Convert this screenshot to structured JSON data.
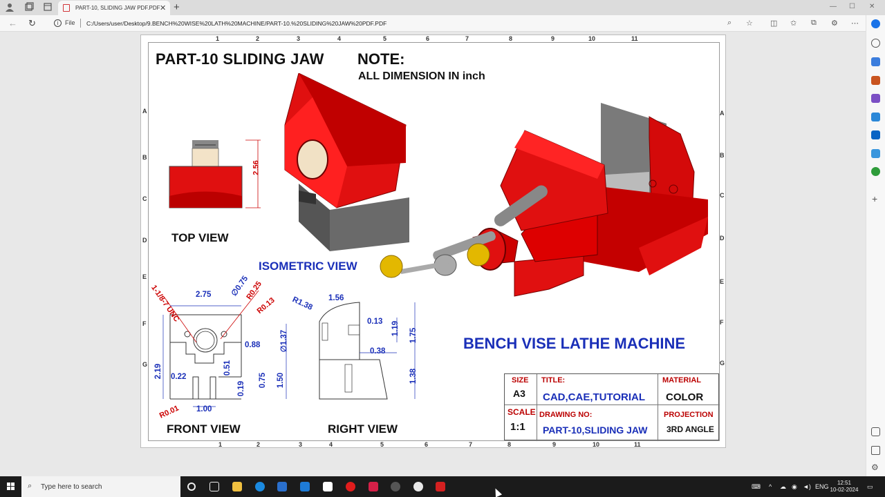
{
  "browser": {
    "tab_title": "PART-10, SLIDING JAW PDF.PDF",
    "file_label": "File",
    "url": "C:/Users/user/Desktop/9.BENCH%20WISE%20LATH%20MACHINE/PART-10.%20SLIDING%20JAW%20PDF.PDF"
  },
  "drawing": {
    "part_title": "PART-10 SLIDING JAW",
    "note_heading": "NOTE:",
    "note_text": "ALL DIMENSION IN inch",
    "top_view_label": "TOP VIEW",
    "isometric_label": "ISOMETRIC VIEW",
    "front_view_label": "FRONT VIEW",
    "right_view_label": "RIGHT VIEW",
    "machine_title": "BENCH VISE LATHE MACHINE",
    "zones_top": [
      "1",
      "2",
      "3",
      "4",
      "5",
      "6",
      "7",
      "8",
      "9",
      "10",
      "11"
    ],
    "zones_bottom": [
      "1",
      "2",
      "3",
      "4",
      "5",
      "6",
      "7",
      "8",
      "9",
      "10",
      "11"
    ],
    "zones_side": [
      "A",
      "B",
      "C",
      "D",
      "E",
      "F",
      "G"
    ],
    "dims": {
      "top_256": "2.56",
      "thread": "1-1/8-7 UNC",
      "d275": "2.75",
      "dia075": "∅0.75",
      "r025": "R0.25",
      "r013": "R0.13",
      "d088": "0.88",
      "dia137": "∅1.37",
      "d219": "2.19",
      "d022": "0.22",
      "d051": "0.51",
      "d019": "0.19",
      "d075": "0.75",
      "d150": "1.50",
      "d100": "1.00",
      "r001": "R0.01",
      "r138": "R1.38",
      "d156": "1.56",
      "d013": "0.13",
      "d119": "1.19",
      "d175": "1.75",
      "d038": "0.38",
      "d138": "1.38"
    },
    "title_block": {
      "size_label": "SIZE",
      "size_value": "A3",
      "title_label": "TITLE:",
      "title_value": "CAD,CAE,TUTORIAL",
      "material_label": "MATERIAL",
      "material_value": "COLOR",
      "scale_label": "SCALE",
      "scale_value": "1:1",
      "drawing_no_label": "DRAWING NO:",
      "drawing_no_value": "PART-10,SLIDING JAW",
      "projection_label": "PROJECTION",
      "projection_value": "3RD ANGLE"
    }
  },
  "taskbar": {
    "search_placeholder": "Type here to search",
    "lang": "ENG",
    "time": "12:51",
    "date": "10-02-2024"
  },
  "colors": {
    "jaw_red": "#e01010",
    "dim_blue": "#1a2fb8",
    "label_red": "#b00000"
  }
}
